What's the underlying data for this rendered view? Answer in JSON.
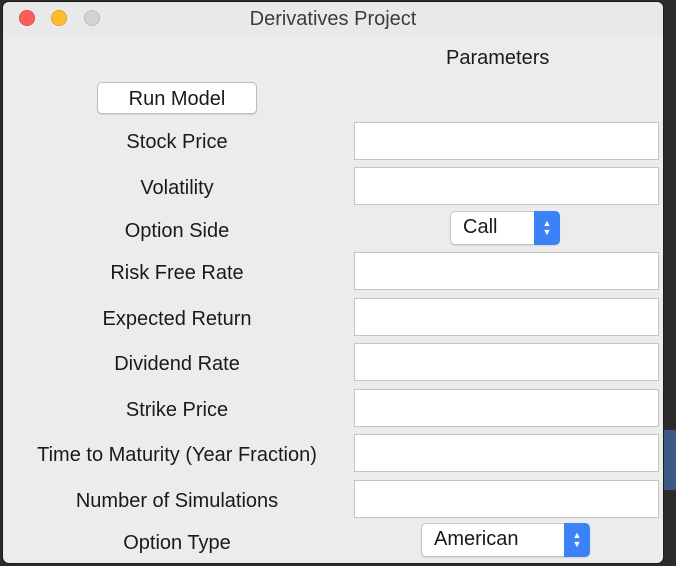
{
  "window": {
    "title": "Derivatives Project"
  },
  "header": {
    "parameters_label": "Parameters"
  },
  "run_button": {
    "label": "Run Model"
  },
  "fields": [
    {
      "label": "Stock Price",
      "value": ""
    },
    {
      "label": "Volatility",
      "value": ""
    },
    {
      "label": "Option Side",
      "selected": "Call"
    },
    {
      "label": "Risk Free Rate",
      "value": ""
    },
    {
      "label": "Expected Return",
      "value": ""
    },
    {
      "label": "Dividend Rate",
      "value": ""
    },
    {
      "label": "Strike Price",
      "value": ""
    },
    {
      "label": "Time to Maturity (Year Fraction)",
      "value": ""
    },
    {
      "label": "Number of Simulations",
      "value": ""
    },
    {
      "label": "Option Type",
      "selected": "American"
    }
  ],
  "colors": {
    "close": "#fd5f57",
    "minimize": "#febc2e",
    "zoom_disabled": "#d3d3d3",
    "select_accent": "#3b82f7"
  }
}
